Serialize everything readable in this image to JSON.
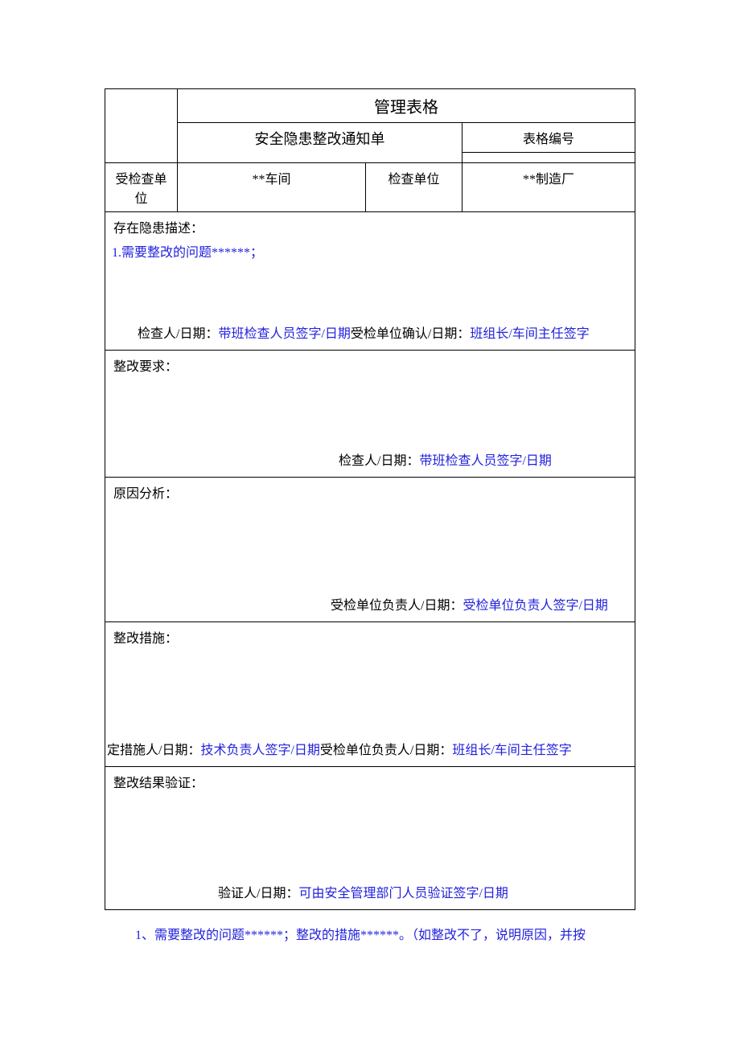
{
  "header": {
    "title": "管理表格",
    "subtitle": "安全隐患整改通知单",
    "form_no_label": "表格编号"
  },
  "info_row": {
    "inspected_unit_label": "受检查单位",
    "inspected_unit_value": "**车间",
    "inspecting_unit_label": "检查单位",
    "inspecting_unit_value": "**制造厂"
  },
  "sections": {
    "hazard": {
      "title": "存在隐患描述：",
      "item1": "1.需要整改的问题******；",
      "sign1_label": "检查人/日期：",
      "sign1_value": "带班检查人员签字/日期",
      "sign2_label": "受检单位确认/日期：",
      "sign2_value": "班组长/车间主任签字"
    },
    "requirement": {
      "title": "整改要求：",
      "sign_label": "检查人/日期：",
      "sign_value": "带班检查人员签字/日期"
    },
    "cause": {
      "title": "原因分析：",
      "sign_label": "受检单位负责人/日期：",
      "sign_value": "受检单位负责人签字/日期"
    },
    "measure": {
      "title": "整改措施：",
      "sign1_label": "定措施人/日期：",
      "sign1_value": "技术负责人签字/日期",
      "sign2_label": "受检单位负责人/日期：",
      "sign2_value": "班组长/车间主任签字"
    },
    "verify": {
      "title": "整改结果验证：",
      "sign_label": "验证人/日期：",
      "sign_value": "可由安全管理部门人员验证签字/日期"
    }
  },
  "footer": {
    "note": "1、需要整改的问题******；整改的措施******。（如整改不了，说明原因，并按"
  }
}
